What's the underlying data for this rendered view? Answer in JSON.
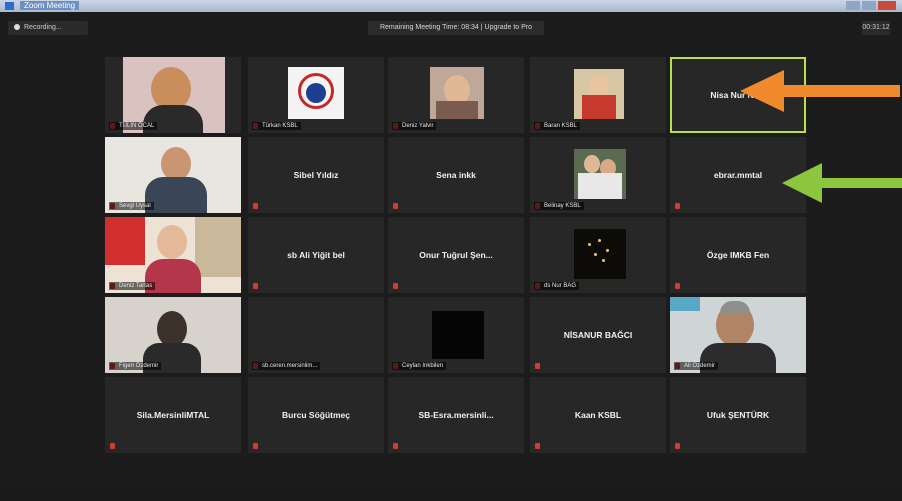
{
  "window": {
    "title": "Zoom Meeting"
  },
  "toolbar": {
    "recording_label": "Recording...",
    "remaining_time": "Remaining Meeting Time: 08:34 | Upgrade to Pro",
    "clock": "00:31:12"
  },
  "participants": [
    {
      "name": "TÜLİN ÖCAL",
      "has_video": true
    },
    {
      "name": "Türkan KSBL",
      "has_video": true
    },
    {
      "name": "Deniz Yalvir",
      "has_video": true
    },
    {
      "name": "Baran KSBL",
      "has_video": true
    },
    {
      "name": "Nisa Nur Nisa",
      "has_video": false,
      "active_speaker": true
    },
    {
      "name": "Sevgi Uysal",
      "has_video": true
    },
    {
      "name": "Sibel Yıldız",
      "has_video": false
    },
    {
      "name": "Sena inkk",
      "has_video": false
    },
    {
      "name": "Belinay KSBL",
      "has_video": true
    },
    {
      "name": "ebrar.mmtal",
      "has_video": false
    },
    {
      "name": "Deniz Tartas",
      "has_video": true
    },
    {
      "name": "sb Ali Yiğit bel",
      "has_video": false
    },
    {
      "name": "Onur Tuğrul Şen...",
      "has_video": false
    },
    {
      "name": "ds Nur BAĞ",
      "has_video": true
    },
    {
      "name": "Özge IMKB Fen",
      "has_video": false
    },
    {
      "name": "Figen Özdemir",
      "has_video": true
    },
    {
      "name": "sb.ceren.mersinlim...",
      "has_video": false
    },
    {
      "name": "Ceylan Inkbilen",
      "has_video": true
    },
    {
      "name": "NİSANUR BAĞCI",
      "has_video": false
    },
    {
      "name": "Ali Özdemir",
      "has_video": true
    },
    {
      "name": "Sila.MersinliMTAL",
      "has_video": false
    },
    {
      "name": "Burcu Söğütmeç",
      "has_video": false
    },
    {
      "name": "SB-Esra.mersinli...",
      "has_video": false
    },
    {
      "name": "Kaan KSBL",
      "has_video": false
    },
    {
      "name": "Ufuk ŞENTÜRK",
      "has_video": false
    }
  ],
  "annotations": {
    "orange_arrow_color": "#f08a2c",
    "green_arrow_color": "#8cc63f"
  }
}
